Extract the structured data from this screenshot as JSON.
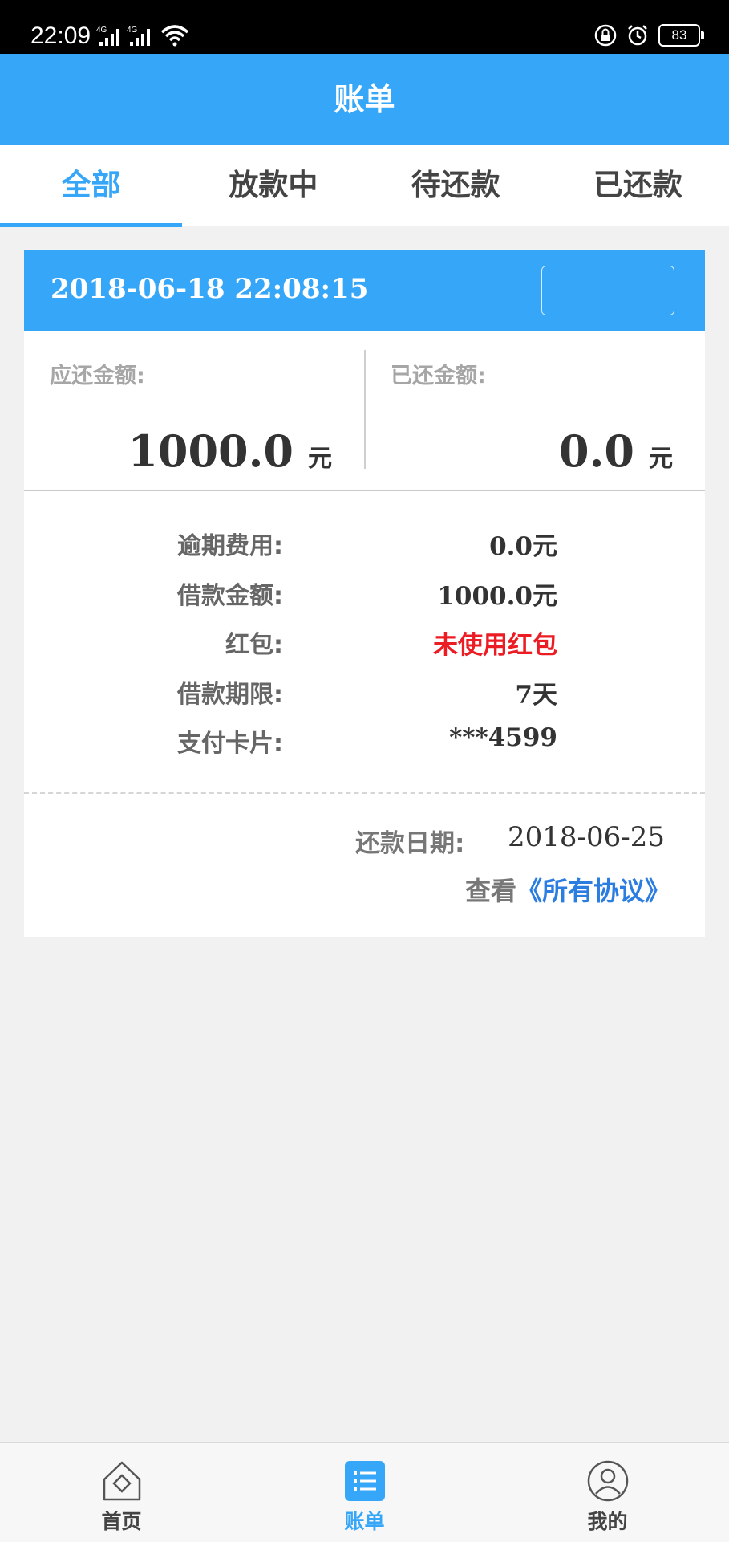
{
  "status_bar": {
    "time": "22:09",
    "signal1": "4G",
    "signal2": "4G",
    "battery": "83"
  },
  "header": {
    "title": "账单"
  },
  "tabs": [
    {
      "label": "全部",
      "active": true
    },
    {
      "label": "放款中",
      "active": false
    },
    {
      "label": "待还款",
      "active": false
    },
    {
      "label": "已还款",
      "active": false
    }
  ],
  "bill": {
    "datetime": "2018-06-18 22:08:15",
    "due_amount": {
      "label": "应还金额:",
      "value": "1000.0",
      "unit": "元"
    },
    "paid_amount": {
      "label": "已还金额:",
      "value": "0.0",
      "unit": "元"
    },
    "details": [
      {
        "label": "逾期费用:",
        "value": "0.0元",
        "highlight": false
      },
      {
        "label": "借款金额:",
        "value": "1000.0元",
        "highlight": false
      },
      {
        "label": "红包:",
        "value": "未使用红包",
        "highlight": true
      },
      {
        "label": "借款期限:",
        "value": "7天",
        "highlight": false
      },
      {
        "label": "支付卡片:",
        "value": "***4599",
        "highlight": false
      }
    ],
    "repay_date_label": "还款日期:",
    "repay_date": "2018-06-25",
    "agreement_prefix": "查看",
    "agreement_link": "《所有协议》"
  },
  "bottom_nav": [
    {
      "label": "首页",
      "icon": "home-icon",
      "active": false
    },
    {
      "label": "账单",
      "icon": "bill-list-icon",
      "active": true
    },
    {
      "label": "我的",
      "icon": "user-icon",
      "active": false
    }
  ],
  "colors": {
    "primary": "#35a6f8",
    "red": "#ec1c24",
    "link": "#2b7de0",
    "background": "#f1f1f2"
  }
}
